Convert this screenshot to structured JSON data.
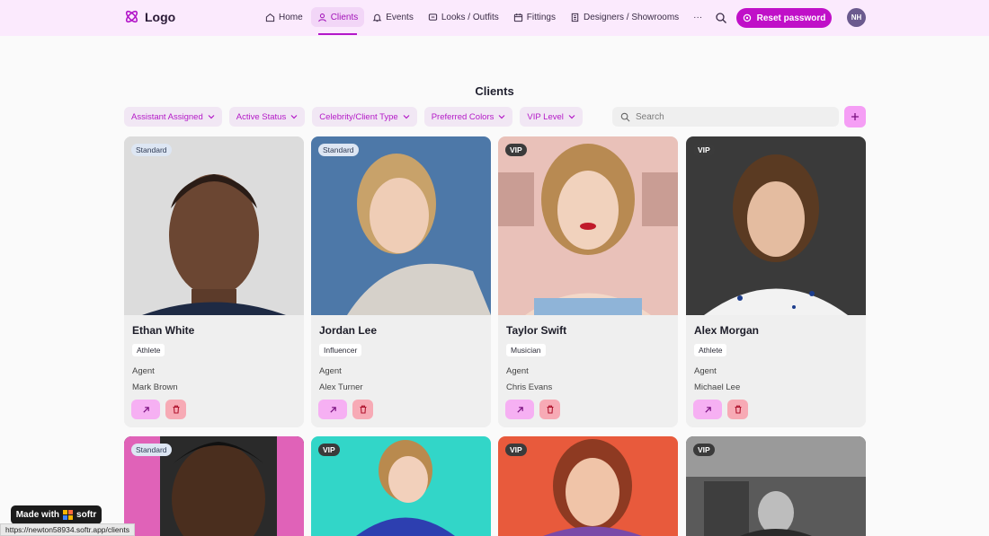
{
  "header": {
    "logo_text": "Logo",
    "nav": [
      {
        "label": "Home",
        "icon": "home-icon"
      },
      {
        "label": "Clients",
        "icon": "user-icon",
        "active": true
      },
      {
        "label": "Events",
        "icon": "bell-icon"
      },
      {
        "label": "Looks / Outfits",
        "icon": "tag-icon"
      },
      {
        "label": "Fittings",
        "icon": "calendar-icon"
      },
      {
        "label": "Designers / Showrooms",
        "icon": "building-icon"
      }
    ],
    "more_label": "···",
    "reset_label": "Reset password",
    "avatar_initials": "NH"
  },
  "page": {
    "title": "Clients"
  },
  "filters": [
    "Assistant Assigned",
    "Active Status",
    "Celebrity/Client Type",
    "Preferred Colors",
    "VIP Level"
  ],
  "search": {
    "placeholder": "Search"
  },
  "agent_label": "Agent",
  "cards": [
    {
      "name": "Ethan White",
      "badge": "Standard",
      "type": "Athlete",
      "agent": "Mark Brown"
    },
    {
      "name": "Jordan Lee",
      "badge": "Standard",
      "type": "Influencer",
      "agent": "Alex Turner"
    },
    {
      "name": "Taylor Swift",
      "badge": "VIP",
      "type": "Musician",
      "agent": "Chris Evans"
    },
    {
      "name": "Alex Morgan",
      "badge": "VIP",
      "type": "Athlete",
      "agent": "Michael Lee"
    },
    {
      "badge": "Standard"
    },
    {
      "badge": "VIP"
    },
    {
      "badge": "VIP"
    },
    {
      "badge": "VIP"
    }
  ],
  "footer": {
    "made_with": "Made with",
    "brand": "softr",
    "status_url": "https://newton58934.softr.app/clients"
  },
  "colors": {
    "accent": "#c010c8",
    "header_bg": "#fbeafd",
    "filter_bg": "#f1e7f4",
    "card_bg": "#efefef"
  }
}
